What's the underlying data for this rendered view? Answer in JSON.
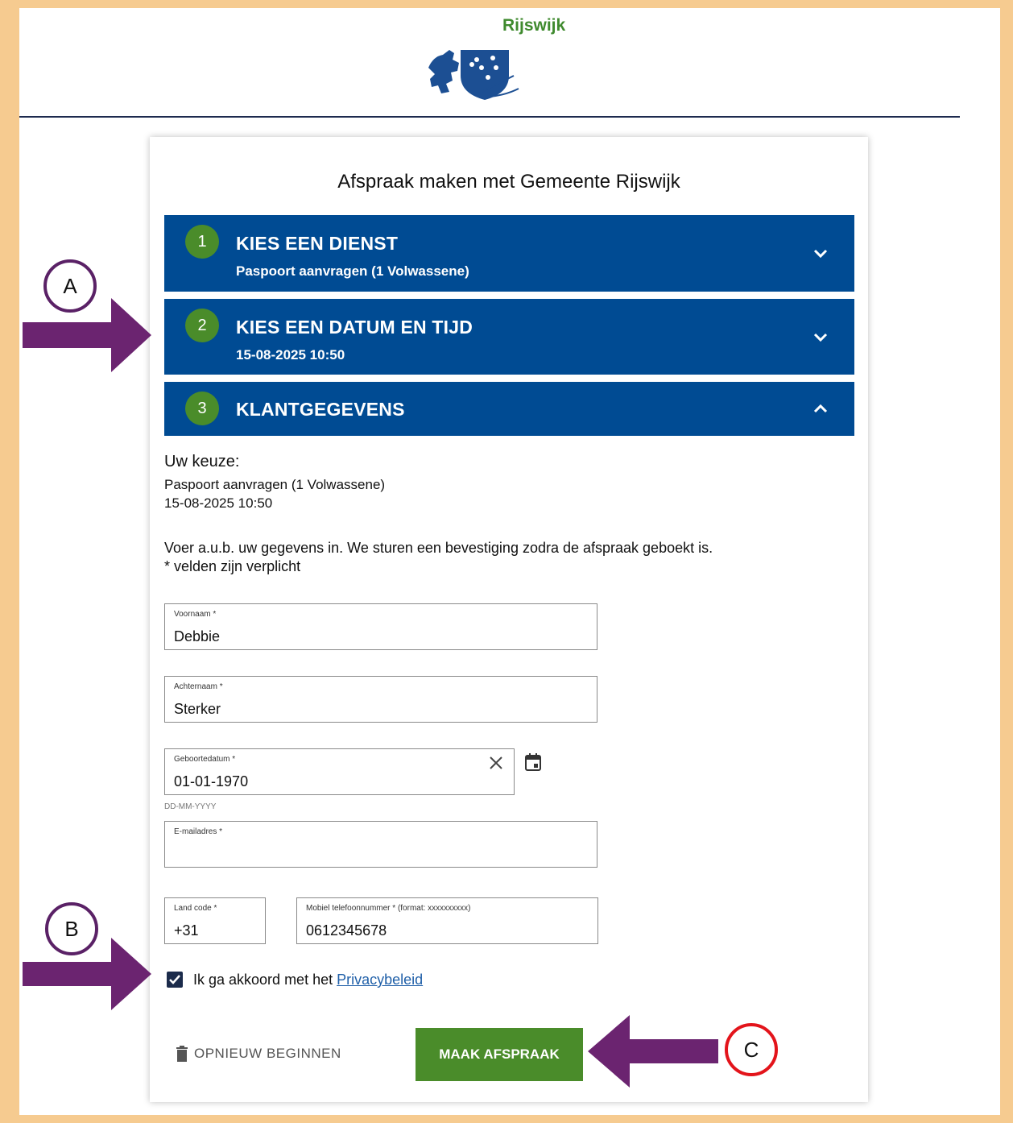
{
  "header": {
    "brand": "Rijswijk"
  },
  "card": {
    "title": "Afspraak maken met Gemeente Rijswijk"
  },
  "steps": [
    {
      "number": "1",
      "title": "KIES EEN DIENST",
      "subtitle": "Paspoort aanvragen (1 Volwassene)",
      "state": "collapsed",
      "icon": "chevron-down-icon"
    },
    {
      "number": "2",
      "title": "KIES EEN DATUM EN TIJD",
      "subtitle": "15-08-2025 10:50",
      "state": "collapsed",
      "icon": "chevron-down-icon"
    },
    {
      "number": "3",
      "title": "KLANTGEGEVENS",
      "subtitle": "",
      "state": "expanded",
      "icon": "chevron-up-icon"
    }
  ],
  "summary": {
    "heading": "Uw keuze:",
    "service": "Paspoort aanvragen (1 Volwassene)",
    "datetime": "15-08-2025 10:50"
  },
  "intro": {
    "line1": "Voer a.u.b. uw gegevens in. We sturen een bevestiging zodra de afspraak geboekt is.",
    "line2": "* velden zijn verplicht"
  },
  "form": {
    "first_name": {
      "label": "Voornaam *",
      "value": "Debbie"
    },
    "last_name": {
      "label": "Achternaam *",
      "value": "Sterker"
    },
    "birthdate": {
      "label": "Geboortedatum *",
      "value": "01-01-1970",
      "hint": "DD-MM-YYYY"
    },
    "email": {
      "label": "E-mailadres *",
      "value": ""
    },
    "country_code": {
      "label": "Land code *",
      "value": "+31"
    },
    "phone": {
      "label": "Mobiel telefoonnummer * (format: xxxxxxxxxx)",
      "value": "0612345678"
    },
    "privacy": {
      "checked": true,
      "text": "Ik ga akkoord met het",
      "link": "Privacybeleid"
    }
  },
  "actions": {
    "restart": "OPNIEUW BEGINNEN",
    "submit": "MAAK AFSPRAAK"
  },
  "callouts": {
    "a": "A",
    "b": "B",
    "c": "C"
  },
  "colors": {
    "accordion": "#004b93",
    "green": "#4a8c2a",
    "callout": "#5a2166",
    "callout_c": "#e3141b",
    "frame": "#f6cb90"
  }
}
